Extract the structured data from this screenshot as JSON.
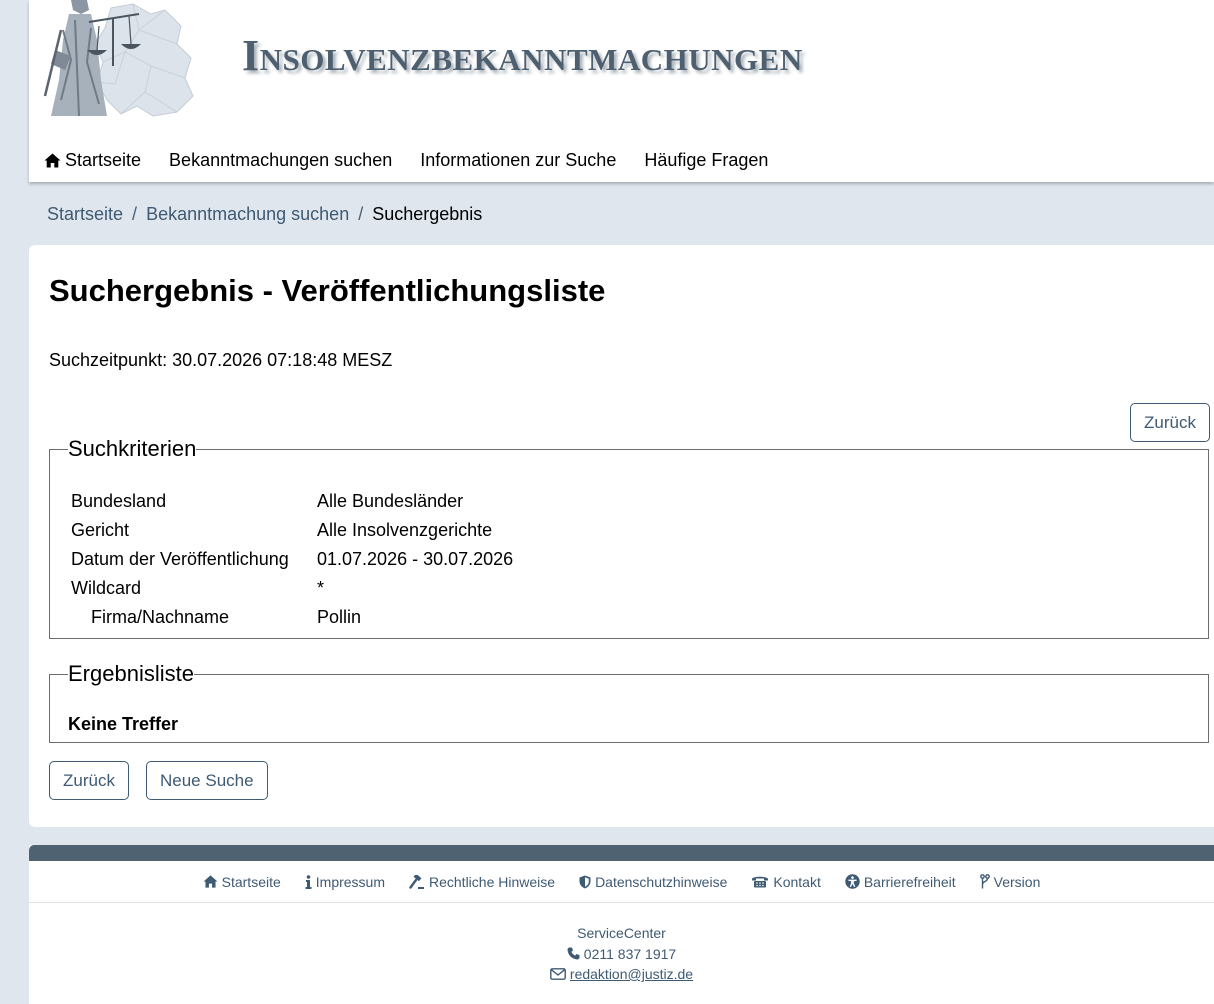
{
  "header": {
    "title": "Insolvenzbekanntmachungen"
  },
  "nav": {
    "items": [
      {
        "label": "Startseite",
        "icon": "home-icon"
      },
      {
        "label": "Bekanntmachungen suchen"
      },
      {
        "label": "Informationen zur Suche"
      },
      {
        "label": "Häufige Fragen"
      }
    ]
  },
  "breadcrumb": {
    "items": [
      "Startseite",
      "Bekanntmachung suchen"
    ],
    "separator": "/",
    "current": "Suchergebnis"
  },
  "main": {
    "title": "Suchergebnis - Veröffentlichungsliste",
    "search_time": "Suchzeitpunkt: 30.07.2026 07:18:48 MESZ",
    "back_label": "Zurück",
    "new_search_label": "Neue Suche",
    "criteria": {
      "legend": "Suchkriterien",
      "rows": [
        {
          "label": "Bundesland",
          "value": "Alle Bundesländer"
        },
        {
          "label": "Gericht",
          "value": "Alle Insolvenzgerichte"
        },
        {
          "label": "Datum der Veröffentlichung",
          "value": "01.07.2026 - 30.07.2026"
        },
        {
          "label": "Wildcard",
          "value": "*"
        },
        {
          "label": "Firma/Nachname",
          "value": "Pollin"
        }
      ]
    },
    "results": {
      "legend": "Ergebnisliste",
      "empty_text": "Keine Treffer"
    }
  },
  "footer": {
    "links": [
      {
        "label": "Startseite",
        "icon": "home-icon"
      },
      {
        "label": "Impressum",
        "icon": "info-icon"
      },
      {
        "label": "Rechtliche Hinweise",
        "icon": "gavel-icon"
      },
      {
        "label": "Datenschutzhinweise",
        "icon": "shield-icon"
      },
      {
        "label": "Kontakt",
        "icon": "phone-office-icon"
      },
      {
        "label": "Barrierefreiheit",
        "icon": "accessibility-icon"
      },
      {
        "label": "Version",
        "icon": "branch-icon"
      }
    ],
    "service": {
      "title": "ServiceCenter",
      "phone": "0211 837 1917",
      "email": "redaktion@justiz.de"
    }
  },
  "colors": {
    "accent": "#3f5a73",
    "footer_bar": "#4e6272",
    "background": "#dfe6ee"
  }
}
